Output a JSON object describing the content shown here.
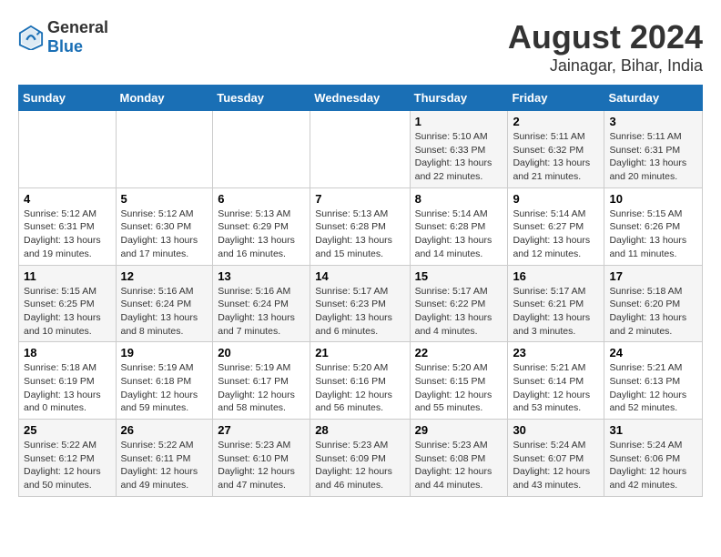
{
  "header": {
    "logo_general": "General",
    "logo_blue": "Blue",
    "title": "August 2024",
    "subtitle": "Jainagar, Bihar, India"
  },
  "days_of_week": [
    "Sunday",
    "Monday",
    "Tuesday",
    "Wednesday",
    "Thursday",
    "Friday",
    "Saturday"
  ],
  "weeks": [
    [
      {
        "day": "",
        "info": ""
      },
      {
        "day": "",
        "info": ""
      },
      {
        "day": "",
        "info": ""
      },
      {
        "day": "",
        "info": ""
      },
      {
        "day": "1",
        "info": "Sunrise: 5:10 AM\nSunset: 6:33 PM\nDaylight: 13 hours and 22 minutes."
      },
      {
        "day": "2",
        "info": "Sunrise: 5:11 AM\nSunset: 6:32 PM\nDaylight: 13 hours and 21 minutes."
      },
      {
        "day": "3",
        "info": "Sunrise: 5:11 AM\nSunset: 6:31 PM\nDaylight: 13 hours and 20 minutes."
      }
    ],
    [
      {
        "day": "4",
        "info": "Sunrise: 5:12 AM\nSunset: 6:31 PM\nDaylight: 13 hours and 19 minutes."
      },
      {
        "day": "5",
        "info": "Sunrise: 5:12 AM\nSunset: 6:30 PM\nDaylight: 13 hours and 17 minutes."
      },
      {
        "day": "6",
        "info": "Sunrise: 5:13 AM\nSunset: 6:29 PM\nDaylight: 13 hours and 16 minutes."
      },
      {
        "day": "7",
        "info": "Sunrise: 5:13 AM\nSunset: 6:28 PM\nDaylight: 13 hours and 15 minutes."
      },
      {
        "day": "8",
        "info": "Sunrise: 5:14 AM\nSunset: 6:28 PM\nDaylight: 13 hours and 14 minutes."
      },
      {
        "day": "9",
        "info": "Sunrise: 5:14 AM\nSunset: 6:27 PM\nDaylight: 13 hours and 12 minutes."
      },
      {
        "day": "10",
        "info": "Sunrise: 5:15 AM\nSunset: 6:26 PM\nDaylight: 13 hours and 11 minutes."
      }
    ],
    [
      {
        "day": "11",
        "info": "Sunrise: 5:15 AM\nSunset: 6:25 PM\nDaylight: 13 hours and 10 minutes."
      },
      {
        "day": "12",
        "info": "Sunrise: 5:16 AM\nSunset: 6:24 PM\nDaylight: 13 hours and 8 minutes."
      },
      {
        "day": "13",
        "info": "Sunrise: 5:16 AM\nSunset: 6:24 PM\nDaylight: 13 hours and 7 minutes."
      },
      {
        "day": "14",
        "info": "Sunrise: 5:17 AM\nSunset: 6:23 PM\nDaylight: 13 hours and 6 minutes."
      },
      {
        "day": "15",
        "info": "Sunrise: 5:17 AM\nSunset: 6:22 PM\nDaylight: 13 hours and 4 minutes."
      },
      {
        "day": "16",
        "info": "Sunrise: 5:17 AM\nSunset: 6:21 PM\nDaylight: 13 hours and 3 minutes."
      },
      {
        "day": "17",
        "info": "Sunrise: 5:18 AM\nSunset: 6:20 PM\nDaylight: 13 hours and 2 minutes."
      }
    ],
    [
      {
        "day": "18",
        "info": "Sunrise: 5:18 AM\nSunset: 6:19 PM\nDaylight: 13 hours and 0 minutes."
      },
      {
        "day": "19",
        "info": "Sunrise: 5:19 AM\nSunset: 6:18 PM\nDaylight: 12 hours and 59 minutes."
      },
      {
        "day": "20",
        "info": "Sunrise: 5:19 AM\nSunset: 6:17 PM\nDaylight: 12 hours and 58 minutes."
      },
      {
        "day": "21",
        "info": "Sunrise: 5:20 AM\nSunset: 6:16 PM\nDaylight: 12 hours and 56 minutes."
      },
      {
        "day": "22",
        "info": "Sunrise: 5:20 AM\nSunset: 6:15 PM\nDaylight: 12 hours and 55 minutes."
      },
      {
        "day": "23",
        "info": "Sunrise: 5:21 AM\nSunset: 6:14 PM\nDaylight: 12 hours and 53 minutes."
      },
      {
        "day": "24",
        "info": "Sunrise: 5:21 AM\nSunset: 6:13 PM\nDaylight: 12 hours and 52 minutes."
      }
    ],
    [
      {
        "day": "25",
        "info": "Sunrise: 5:22 AM\nSunset: 6:12 PM\nDaylight: 12 hours and 50 minutes."
      },
      {
        "day": "26",
        "info": "Sunrise: 5:22 AM\nSunset: 6:11 PM\nDaylight: 12 hours and 49 minutes."
      },
      {
        "day": "27",
        "info": "Sunrise: 5:23 AM\nSunset: 6:10 PM\nDaylight: 12 hours and 47 minutes."
      },
      {
        "day": "28",
        "info": "Sunrise: 5:23 AM\nSunset: 6:09 PM\nDaylight: 12 hours and 46 minutes."
      },
      {
        "day": "29",
        "info": "Sunrise: 5:23 AM\nSunset: 6:08 PM\nDaylight: 12 hours and 44 minutes."
      },
      {
        "day": "30",
        "info": "Sunrise: 5:24 AM\nSunset: 6:07 PM\nDaylight: 12 hours and 43 minutes."
      },
      {
        "day": "31",
        "info": "Sunrise: 5:24 AM\nSunset: 6:06 PM\nDaylight: 12 hours and 42 minutes."
      }
    ]
  ]
}
